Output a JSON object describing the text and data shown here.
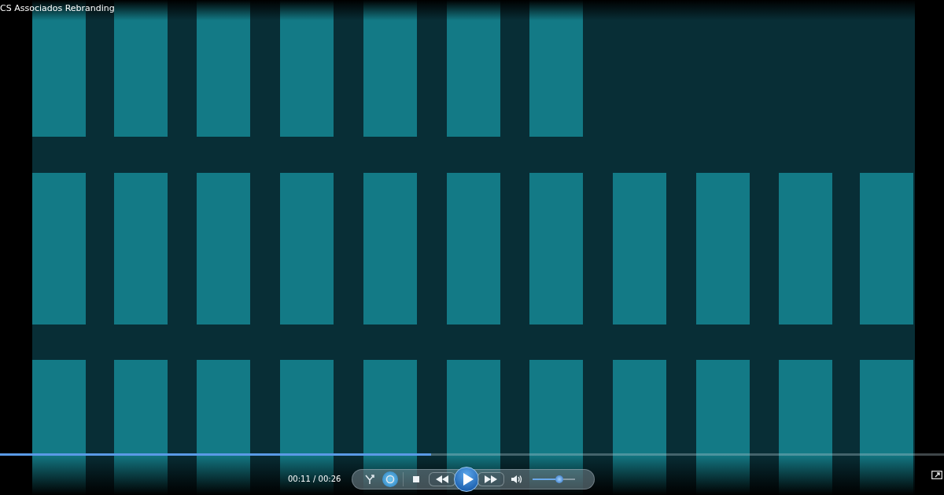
{
  "window": {
    "title": "CS Associados Rebranding"
  },
  "seek_bar": {
    "level": 0.457
  },
  "player_controls": {
    "time": "00:11 / 00:26",
    "shuffle_on": false,
    "repeat_on": true,
    "volume": {
      "level": 0.63
    }
  }
}
